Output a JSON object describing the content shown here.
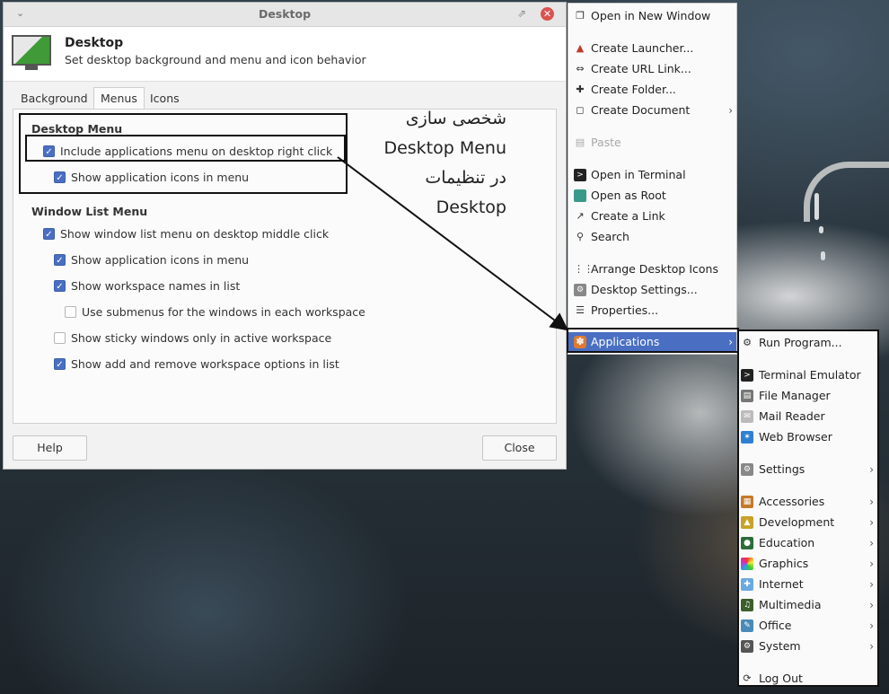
{
  "window": {
    "title": "Desktop",
    "header_title": "Desktop",
    "header_subtitle": "Set desktop background and menu and icon behavior",
    "tabs": [
      {
        "label": "Background"
      },
      {
        "label": "Menus",
        "active": true
      },
      {
        "label": "Icons"
      }
    ],
    "desktop_menu_title": "Desktop Menu",
    "desktop_menu_options": [
      {
        "label": "Include applications menu on desktop right click",
        "checked": true
      },
      {
        "label": "Show application icons in menu",
        "checked": true
      }
    ],
    "window_list_title": "Window List Menu",
    "window_list_options": [
      {
        "label": "Show window list menu on desktop middle click",
        "checked": true
      },
      {
        "label": "Show application icons in menu",
        "checked": true
      },
      {
        "label": "Show workspace names in list",
        "checked": true
      },
      {
        "label": "Use submenus for the windows in each workspace",
        "checked": false
      },
      {
        "label": "Show sticky windows only in active workspace",
        "checked": false
      },
      {
        "label": "Show add and remove workspace options in list",
        "checked": true
      }
    ],
    "help_label": "Help",
    "close_label": "Close"
  },
  "annotation": {
    "line1": "شخصی سازی",
    "line2": "Desktop Menu",
    "line3": "در تنظیمات",
    "line4": "Desktop"
  },
  "context_menu": {
    "items": [
      {
        "label": "Open in New Window",
        "icon": "window-icon"
      },
      {
        "label": "Create Launcher...",
        "icon": "launcher-icon"
      },
      {
        "label": "Create URL Link...",
        "icon": "url-link-icon"
      },
      {
        "label": "Create Folder...",
        "icon": "folder-icon"
      },
      {
        "label": "Create Document",
        "icon": "document-icon",
        "submenu": true
      },
      {
        "label": "Paste",
        "icon": "paste-icon",
        "disabled": true
      },
      {
        "label": "Open in Terminal",
        "icon": "terminal-icon"
      },
      {
        "label": "Open as Root",
        "icon": "root-icon"
      },
      {
        "label": "Create a Link",
        "icon": "link-icon"
      },
      {
        "label": "Search",
        "icon": "search-icon"
      },
      {
        "label": "Arrange Desktop Icons",
        "icon": "arrange-icon"
      },
      {
        "label": "Desktop Settings...",
        "icon": "desktop-settings-icon"
      },
      {
        "label": "Properties...",
        "icon": "properties-icon"
      },
      {
        "label": "Applications",
        "icon": "applications-icon",
        "submenu": true,
        "highlighted": true
      }
    ]
  },
  "applications_menu": {
    "items": [
      {
        "label": "Run Program...",
        "icon": "gear-icon"
      },
      {
        "label": "Terminal Emulator",
        "icon": "terminal-icon"
      },
      {
        "label": "File Manager",
        "icon": "file-manager-icon"
      },
      {
        "label": "Mail Reader",
        "icon": "mail-icon"
      },
      {
        "label": "Web Browser",
        "icon": "web-browser-icon"
      },
      {
        "label": "Settings",
        "icon": "settings-icon",
        "submenu": true
      },
      {
        "label": "Accessories",
        "icon": "accessories-icon",
        "submenu": true
      },
      {
        "label": "Development",
        "icon": "development-icon",
        "submenu": true
      },
      {
        "label": "Education",
        "icon": "education-icon",
        "submenu": true
      },
      {
        "label": "Graphics",
        "icon": "graphics-icon",
        "submenu": true
      },
      {
        "label": "Internet",
        "icon": "internet-icon",
        "submenu": true
      },
      {
        "label": "Multimedia",
        "icon": "multimedia-icon",
        "submenu": true
      },
      {
        "label": "Office",
        "icon": "office-icon",
        "submenu": true
      },
      {
        "label": "System",
        "icon": "system-icon",
        "submenu": true
      },
      {
        "label": "Log Out",
        "icon": "logout-icon"
      }
    ]
  },
  "colors": {
    "accent": "#4a6fc2",
    "checkbox_on": "#4a6fc2",
    "close_button": "#d9534f"
  }
}
